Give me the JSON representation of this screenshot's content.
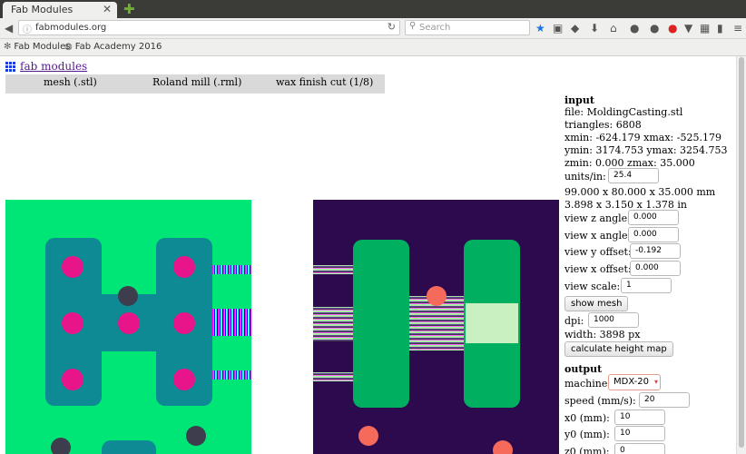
{
  "browser": {
    "tab_title": "Fab Modules",
    "tab_close": "✕",
    "new_tab": "✚",
    "url": "fabmodules.org",
    "search_placeholder": "Search",
    "bookmarks": [
      {
        "label": "Fab Modules"
      },
      {
        "label": "Fab Academy 2016"
      }
    ]
  },
  "page": {
    "logo_text": "fab modules",
    "steps": [
      "mesh (.stl)",
      "Roland mill (.rml)",
      "wax finish cut (1/8)"
    ]
  },
  "sidebar": {
    "input_heading": "input",
    "file": "file: MoldingCasting.stl",
    "triangles": "triangles: 6808",
    "xrange": "xmin: -624.179 xmax: -525.179",
    "yrange": "ymin: 3174.753 ymax: 3254.753",
    "zrange": "zmin: 0.000 zmax: 35.000",
    "units_label": "units/in:",
    "units_value": "25.4",
    "size_mm": "99.000 x 80.000 x 35.000 mm",
    "size_in": "3.898 x 3.150 x 1.378 in",
    "view_z_angle_label": "view z angle:",
    "view_z_angle_value": "0.000",
    "view_x_angle_label": "view x angle:",
    "view_x_angle_value": "0.000",
    "view_y_offset_label": "view y offset:",
    "view_y_offset_value": "-0.192",
    "view_x_offset_label": "view x offset:",
    "view_x_offset_value": "0.000",
    "view_scale_label": "view scale:",
    "view_scale_value": "1",
    "show_mesh_button": "show mesh",
    "dpi_label": "dpi:",
    "dpi_value": "1000",
    "width": "width: 3898 px",
    "calc_button": "calculate height map",
    "output_heading": "output",
    "machine_label": "machine",
    "machine_value": "MDX-20",
    "speed_label": "speed (mm/s):",
    "speed_value": "20",
    "x0_label": "x0 (mm):",
    "x0_value": "10",
    "y0_label": "y0 (mm):",
    "y0_value": "10",
    "z0_label": "z0 (mm):",
    "z0_value": "0"
  },
  "colors": {
    "left_background": "#00e676",
    "left_shape": "#0e8a94",
    "left_holes": "#e8158a",
    "right_background": "#2d0a4e",
    "right_shape": "#00b060",
    "right_holes": "#f56a5a"
  }
}
